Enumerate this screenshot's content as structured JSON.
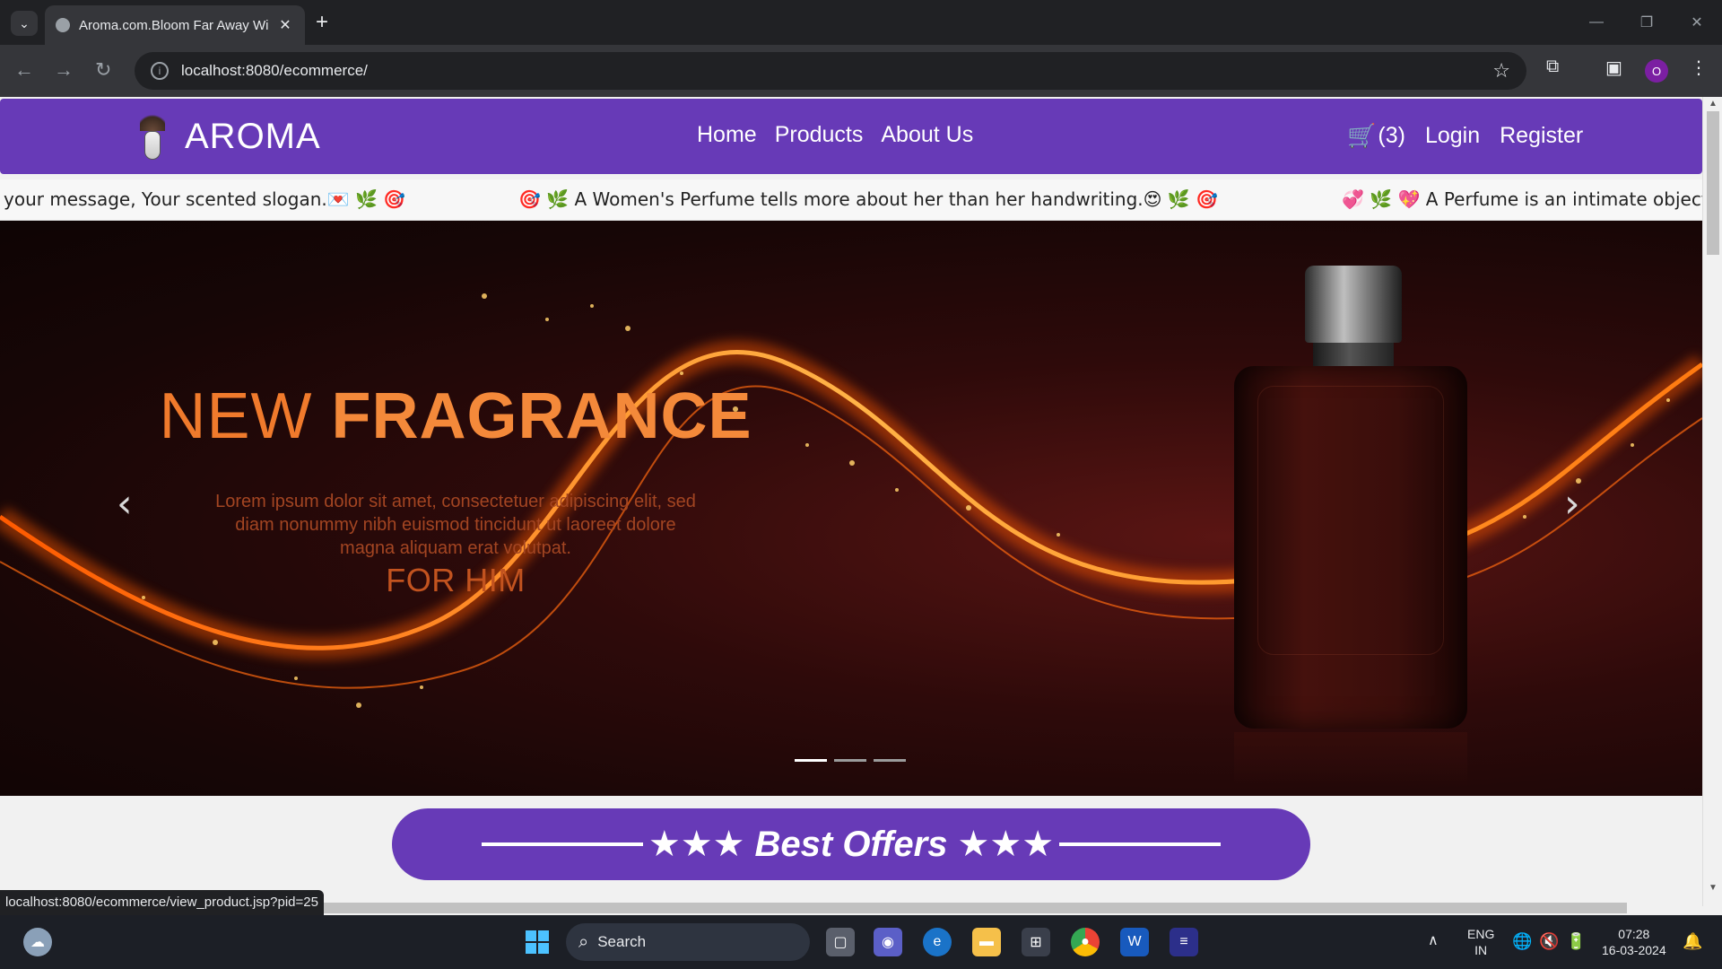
{
  "browser": {
    "tab_title": "Aroma.com.Bloom Far Away Wi",
    "url": "localhost:8080/ecommerce/",
    "profile_initial": "O",
    "status_url": "localhost:8080/ecommerce/view_product.jsp?pid=25"
  },
  "site": {
    "brand": "AROMA",
    "nav": [
      "Home",
      "Products",
      "About Us"
    ],
    "cart_count": "(3)",
    "login": "Login",
    "register": "Register",
    "marquee": [
      "your message, Your scented slogan.💌 🌿 🎯",
      "🎯 🌿 A Women's Perfume tells more about her than her handwriting.😍 🌿 🎯",
      "💞 🌿 💖 A Perfume is an intimate object"
    ],
    "hero": {
      "title_light": "NEW",
      "title_bold": "FRAGRANCE",
      "description": "Lorem ipsum dolor sit amet, consectetuer adipiscing elit, sed diam nonummy nibh euismod tincidunt ut laoreet dolore magna aliquam erat volutpat.",
      "subtitle": "FOR HIM",
      "slides": 3,
      "active_slide": 1
    },
    "offers_text": "★★★ Best Offers ★★★"
  },
  "taskbar": {
    "search_label": "Search",
    "lang_top": "ENG",
    "lang_bottom": "IN",
    "time": "07:28",
    "date": "16-03-2024"
  },
  "colors": {
    "brand_purple": "#673ab7",
    "hero_orange": "#f07a2c"
  }
}
